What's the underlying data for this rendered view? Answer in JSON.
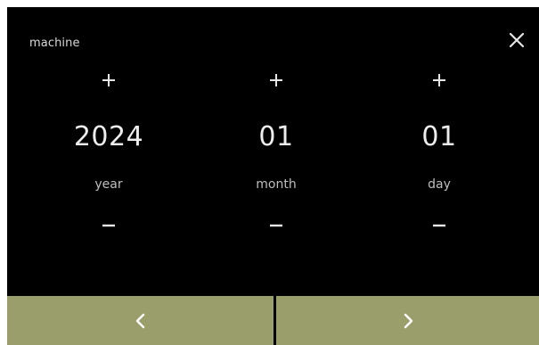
{
  "header": {
    "title": "machine"
  },
  "date": {
    "year": {
      "value": "2024",
      "label": "year"
    },
    "month": {
      "value": "01",
      "label": "month"
    },
    "day": {
      "value": "01",
      "label": "day"
    }
  },
  "icons": {
    "close": "close-icon",
    "increment": "plus-icon",
    "decrement": "minus-icon",
    "previous": "chevron-left-icon",
    "next": "chevron-right-icon"
  },
  "colors": {
    "background": "#000000",
    "text": "#ededed",
    "nav_bar": "#9a9e6a"
  }
}
